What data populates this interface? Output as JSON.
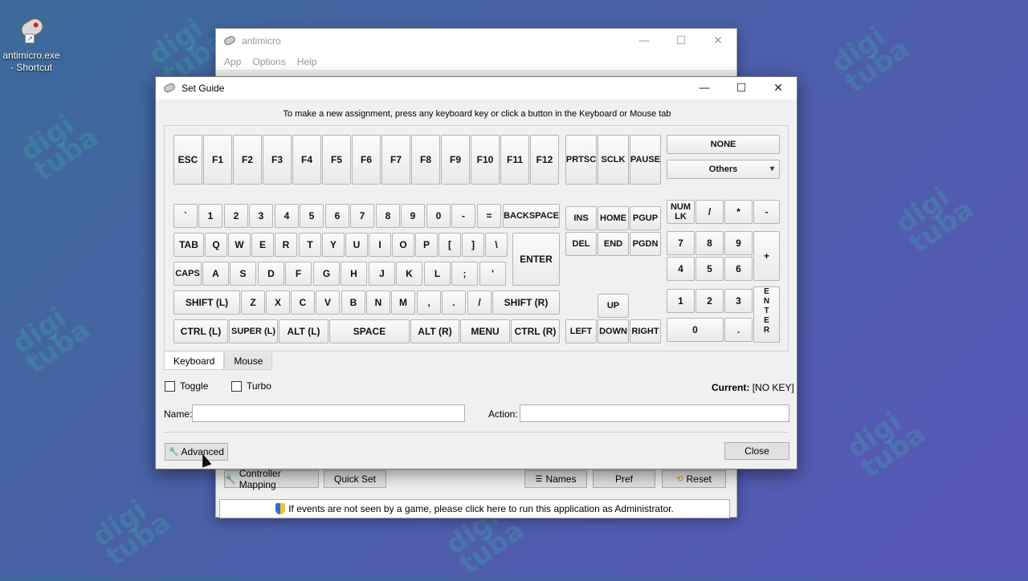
{
  "desktop": {
    "shortcut_label": "antimicro.exe\n- Shortcut",
    "watermark": "digi\ntuba"
  },
  "main_window": {
    "title": "antimicro",
    "menu": [
      "App",
      "Options",
      "Help"
    ],
    "buttons": {
      "controller_mapping": "Controller Mapping",
      "quick_set": "Quick Set",
      "names": "Names",
      "pref": "Pref",
      "reset": "Reset"
    },
    "admin_notice": "If events are not seen by a game, please click here to run this application as Administrator."
  },
  "dialog": {
    "title": "Set Guide",
    "hint": "To make a new assignment, press any keyboard key or click a button in the Keyboard or Mouse tab",
    "keyboard": {
      "fn_row": [
        "ESC",
        "F1",
        "F2",
        "F3",
        "F4",
        "F5",
        "F6",
        "F7",
        "F8",
        "F9",
        "F10",
        "F11",
        "F12"
      ],
      "sys_keys": [
        "PRTSC",
        "SCLK",
        "PAUSE"
      ],
      "none_button": "NONE",
      "others_dropdown": "Others",
      "num_row": [
        "`",
        "1",
        "2",
        "3",
        "4",
        "5",
        "6",
        "7",
        "8",
        "9",
        "0",
        "-",
        "=",
        "BACKSPACE"
      ],
      "tab_row": [
        "TAB",
        "Q",
        "W",
        "E",
        "R",
        "T",
        "Y",
        "U",
        "I",
        "O",
        "P",
        "[",
        "]",
        "\\"
      ],
      "enter": "ENTER",
      "caps_row": [
        "CAPS",
        "A",
        "S",
        "D",
        "F",
        "G",
        "H",
        "J",
        "K",
        "L",
        ";",
        "'"
      ],
      "shift_row": [
        "SHIFT (L)",
        "Z",
        "X",
        "C",
        "V",
        "B",
        "N",
        "M",
        ",",
        ".",
        "/",
        "SHIFT (R)"
      ],
      "bottom_row": [
        "CTRL (L)",
        "SUPER (L)",
        "ALT (L)",
        "SPACE",
        "ALT (R)",
        "MENU",
        "CTRL (R)"
      ],
      "nav_top": [
        "INS",
        "HOME",
        "PGUP"
      ],
      "nav_bottom": [
        "DEL",
        "END",
        "PGDN"
      ],
      "arrows": [
        "UP",
        "LEFT",
        "DOWN",
        "RIGHT"
      ],
      "numpad": {
        "numlock": "NUM\nLK",
        "divide": "/",
        "multiply": "*",
        "minus": "-",
        "n7": "7",
        "n8": "8",
        "n9": "9",
        "plus": "+",
        "n4": "4",
        "n5": "5",
        "n6": "6",
        "n1": "1",
        "n2": "2",
        "n3": "3",
        "enter": "E\nN\nT\nE\nR",
        "n0": "0",
        "dot": "."
      }
    },
    "tabs": [
      "Keyboard",
      "Mouse"
    ],
    "toggle_label": "Toggle",
    "turbo_label": "Turbo",
    "current_label": "Current:",
    "current_value": "[NO KEY]",
    "name_label": "Name:",
    "name_value": "",
    "action_label": "Action:",
    "action_value": "",
    "advanced_button": "Advanced",
    "close_button": "Close"
  }
}
